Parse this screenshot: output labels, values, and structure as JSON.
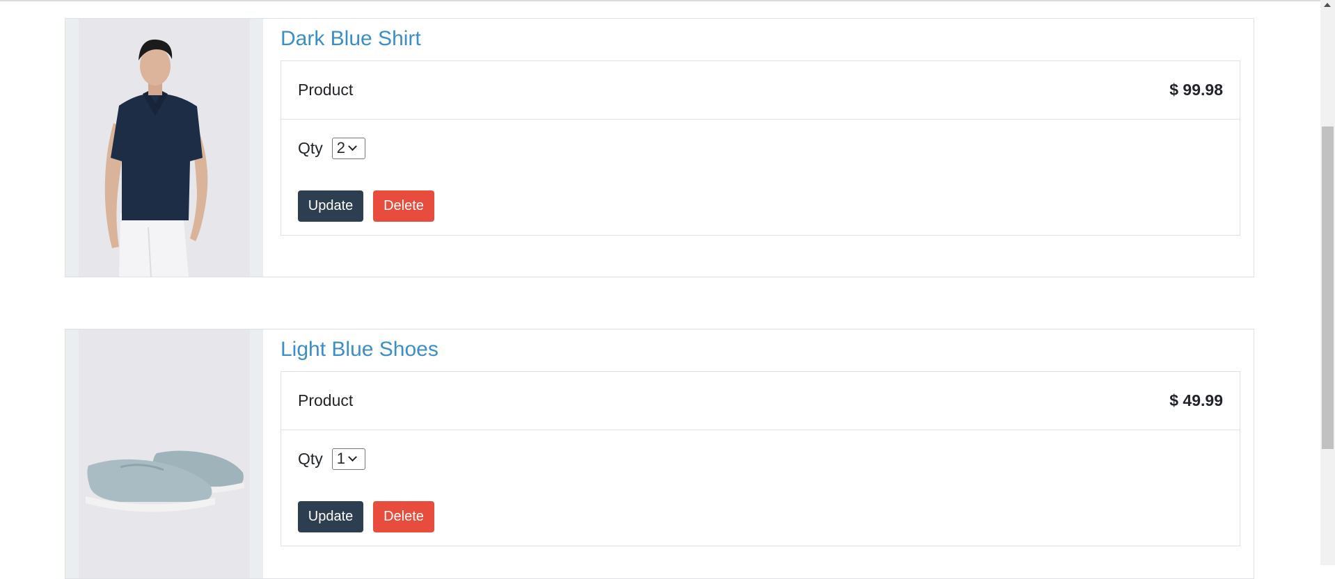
{
  "products": [
    {
      "title": "Dark Blue Shirt",
      "product_label": "Product",
      "price": "$ 99.98",
      "qty_label": "Qty",
      "qty_value": "2",
      "update_label": "Update",
      "delete_label": "Delete",
      "image": "model-in-dark-blue-polo-shirt"
    },
    {
      "title": "Light Blue Shoes",
      "product_label": "Product",
      "price": "$ 49.99",
      "qty_label": "Qty",
      "qty_value": "1",
      "update_label": "Update",
      "delete_label": "Delete",
      "image": "light-blue-suede-loafers"
    }
  ],
  "colors": {
    "title_link": "#3b8fc8",
    "update_button": "#2c3e50",
    "delete_button": "#e74c3c"
  }
}
